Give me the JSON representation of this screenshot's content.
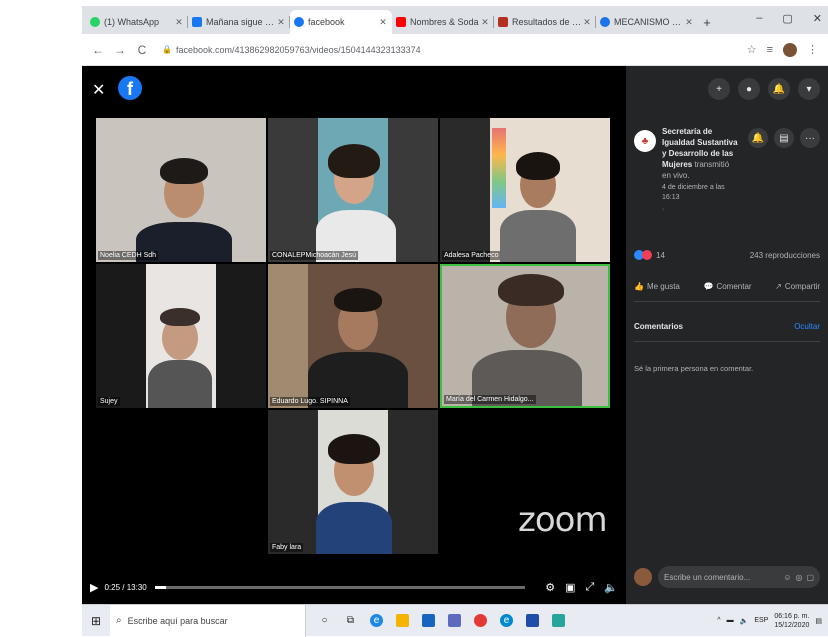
{
  "browser": {
    "tabs": [
      {
        "label": "(1) WhatsApp",
        "favicon_color": "#25d366"
      },
      {
        "label": "Mañana sigue por les",
        "favicon_color": "#1877f2"
      },
      {
        "label": "facebook",
        "favicon_color": "#1877f2",
        "active": true
      },
      {
        "label": "Nombres & Soda",
        "favicon_color": "#ff0000"
      },
      {
        "label": "Resultados de la búsqu",
        "favicon_color": "#b23121"
      },
      {
        "label": "MECANISMO DE RATIF",
        "favicon_color": "#1a73e8"
      }
    ],
    "new_tab": "+",
    "window_controls": {
      "minimize": "–",
      "maximize": "▢",
      "close": "✕"
    },
    "nav": {
      "back": "←",
      "forward": "→",
      "reload": "C"
    },
    "url": "facebook.com/413862982059763/videos/1504144323133374"
  },
  "viewer": {
    "close_glyph": "✕",
    "logo_letter": "f",
    "participants": [
      {
        "name": "Noelia CEDH Sdh"
      },
      {
        "name": "CONALEPMichoacán Jesú"
      },
      {
        "name": "Adalesa Pacheco"
      },
      {
        "name": "Sujey"
      },
      {
        "name": "Eduardo Lugo. SIPINNA"
      },
      {
        "name": "María del Carmen Hidalgo...",
        "speaking": true
      },
      {
        "name": "Faby lara"
      }
    ],
    "zoom_logo": "zoom",
    "controls": {
      "time": "0:25 / 13:30",
      "progress": 0.03,
      "icons": [
        "play-icon",
        "settings-icon",
        "pip-icon",
        "fullscreen-icon",
        "volume-icon"
      ]
    }
  },
  "panel": {
    "top_icons": [
      "+",
      "●",
      "🔔",
      "▾"
    ],
    "page": {
      "name": "Secretaría de Igualdad Sustantiva y Desarrollo de las Mujeres",
      "status": "transmitió en vivo.",
      "date": "4 de diciembre a las 16:13",
      "privacy": "·",
      "avatar_glyph": "♣"
    },
    "reactions": {
      "count": "14",
      "views": "243 reproducciones"
    },
    "actions": {
      "like": "Me gusta",
      "comment": "Comentar",
      "share": "Compartir"
    },
    "comments": {
      "title": "Comentarios",
      "hide": "Ocultar",
      "empty": "Sé la primera persona en comentar.",
      "placeholder": "Escribe un comentario..."
    }
  },
  "taskbar": {
    "search_placeholder": "Escribe aquí para buscar",
    "lang": "ESP",
    "time": "06:16 p. m.",
    "date": "15/12/2020"
  },
  "colors": {
    "facebook_blue": "#1877f2",
    "panel_bg": "#242526",
    "speaker_border": "#3fbf3f",
    "link_blue": "#2d88ff"
  }
}
